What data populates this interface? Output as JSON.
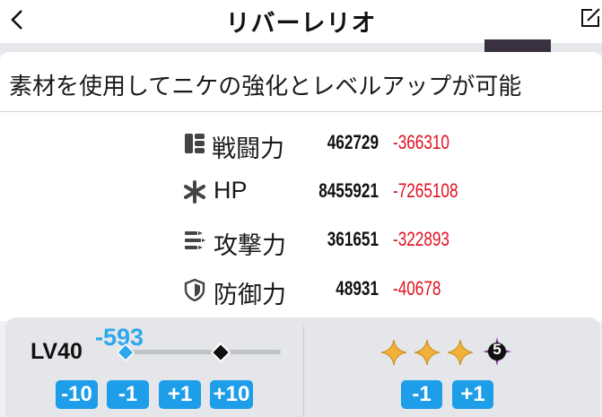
{
  "header": {
    "title": "リバーレリオ"
  },
  "card": {
    "heading": "素材を使用してニケの強化とレベルアップが可能",
    "stats": [
      {
        "icon": "power-icon",
        "name": "戦闘力",
        "value": "462729",
        "diff": "-366310"
      },
      {
        "icon": "hp-icon",
        "name": "HP",
        "value": "8455921",
        "diff": "-7265108"
      },
      {
        "icon": "attack-icon",
        "name": "攻撃力",
        "value": "361651",
        "diff": "-322893"
      },
      {
        "icon": "defense-icon",
        "name": "防御力",
        "value": "48931",
        "diff": "-40678"
      }
    ]
  },
  "level": {
    "label": "LV40",
    "diff": "-593",
    "buttons": [
      "-10",
      "-1",
      "+1",
      "+10"
    ]
  },
  "stars": {
    "filled": 3,
    "badge": "5",
    "buttons": [
      "-1",
      "+1"
    ]
  },
  "colors": {
    "accent": "#1e9ee8",
    "negative": "#e01020",
    "star": "#f2b23a",
    "badge": "#7a2c8c"
  }
}
